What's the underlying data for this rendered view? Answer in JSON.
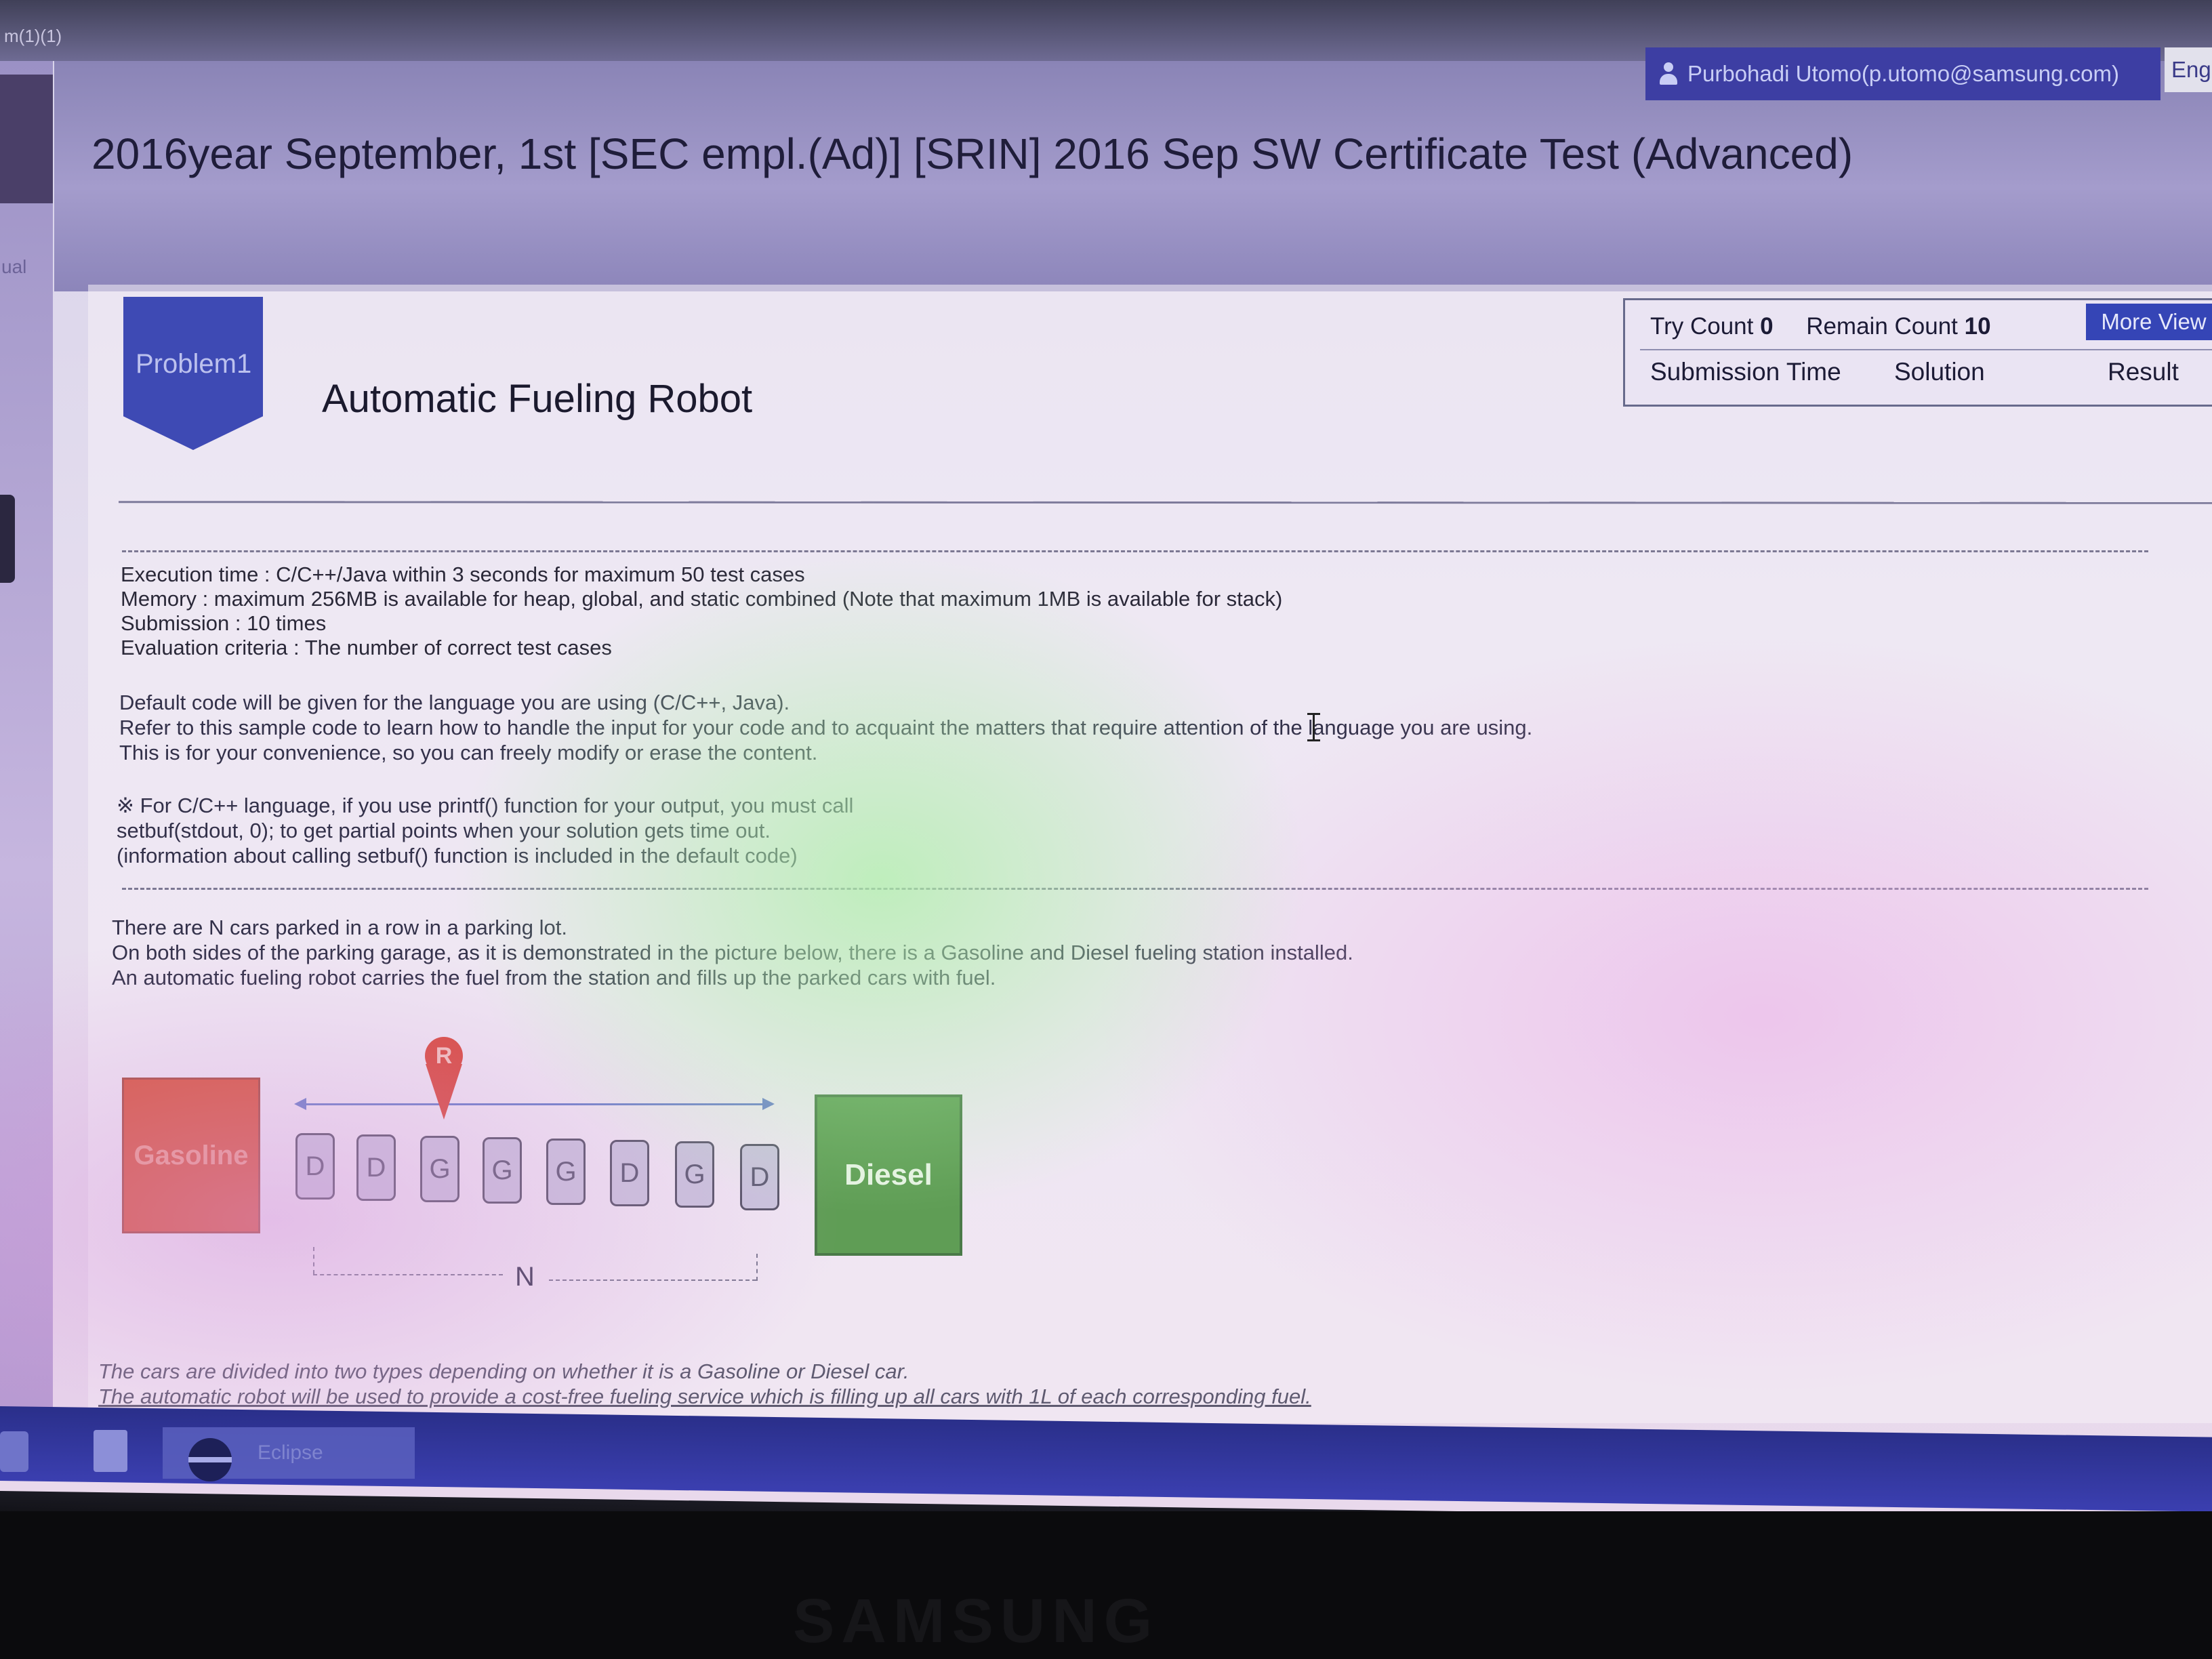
{
  "window": {
    "top_strip_text": "m(1)(1)"
  },
  "left_rail": {
    "label": "ual"
  },
  "user": {
    "name": "Purbohadi Utomo(p.utomo@samsung.com)",
    "language": "Eng"
  },
  "page_title": "2016year September, 1st [SEC empl.(Ad)] [SRIN] 2016 Sep SW Certificate Test (Advanced)",
  "problem": {
    "badge": "Problem1",
    "title": "Automatic Fueling Robot"
  },
  "stats": {
    "try_count_label": "Try Count",
    "try_count": "0",
    "remain_count_label": "Remain Count",
    "remain_count": "10",
    "more_view": "More View",
    "columns": [
      "Submission Time",
      "Solution",
      "Result"
    ]
  },
  "limits": [
    {
      "label": "Execution time : ",
      "value": "C/C++/Java within 3 seconds for maximum 50 test cases"
    },
    {
      "label": "Memory : ",
      "value": "maximum 256MB is available for heap, global, and static combined (Note that maximum 1MB is available for stack)"
    },
    {
      "label": "Submission : ",
      "value": "10 times"
    },
    {
      "label": "Evaluation criteria : ",
      "value": "The number of correct test cases"
    }
  ],
  "default_code_notes": [
    "Default code will be given for the language you are using (C/C++, Java).",
    "Refer to this sample code to learn how to handle the input for your code and to acquaint the matters that require attention of the language you are using.",
    "This is for your convenience, so you can freely modify or erase the content."
  ],
  "cpp_notes": [
    "※ For C/C++ language, if you use printf() function for your output, you must call",
    "setbuf(stdout, 0); to get partial points when your solution gets time out.",
    "(information about calling setbuf() function is included in the default code)"
  ],
  "description": [
    "There are N cars parked in a row in a parking lot.",
    "On both sides of the parking garage, as it is demonstrated in the picture below, there is a Gasoline and Diesel fueling station installed.",
    "An automatic fueling robot carries the fuel from the station and fills up the parked cars with fuel."
  ],
  "diagram": {
    "gasoline_label": "Gasoline",
    "diesel_label": "Diesel",
    "robot_label": "R",
    "cars": [
      "D",
      "D",
      "G",
      "G",
      "G",
      "D",
      "G",
      "D"
    ],
    "n_label": "N"
  },
  "description_2": [
    "The cars are divided into two types depending on whether it is a Gasoline or Diesel car.",
    "The automatic robot will be used to provide a cost-free fueling service which is filling up all cars with 1L of each corresponding fuel."
  ],
  "taskbar": {
    "app_label": "Eclipse"
  },
  "bezel": {
    "brand": "SAMSUNG"
  }
}
